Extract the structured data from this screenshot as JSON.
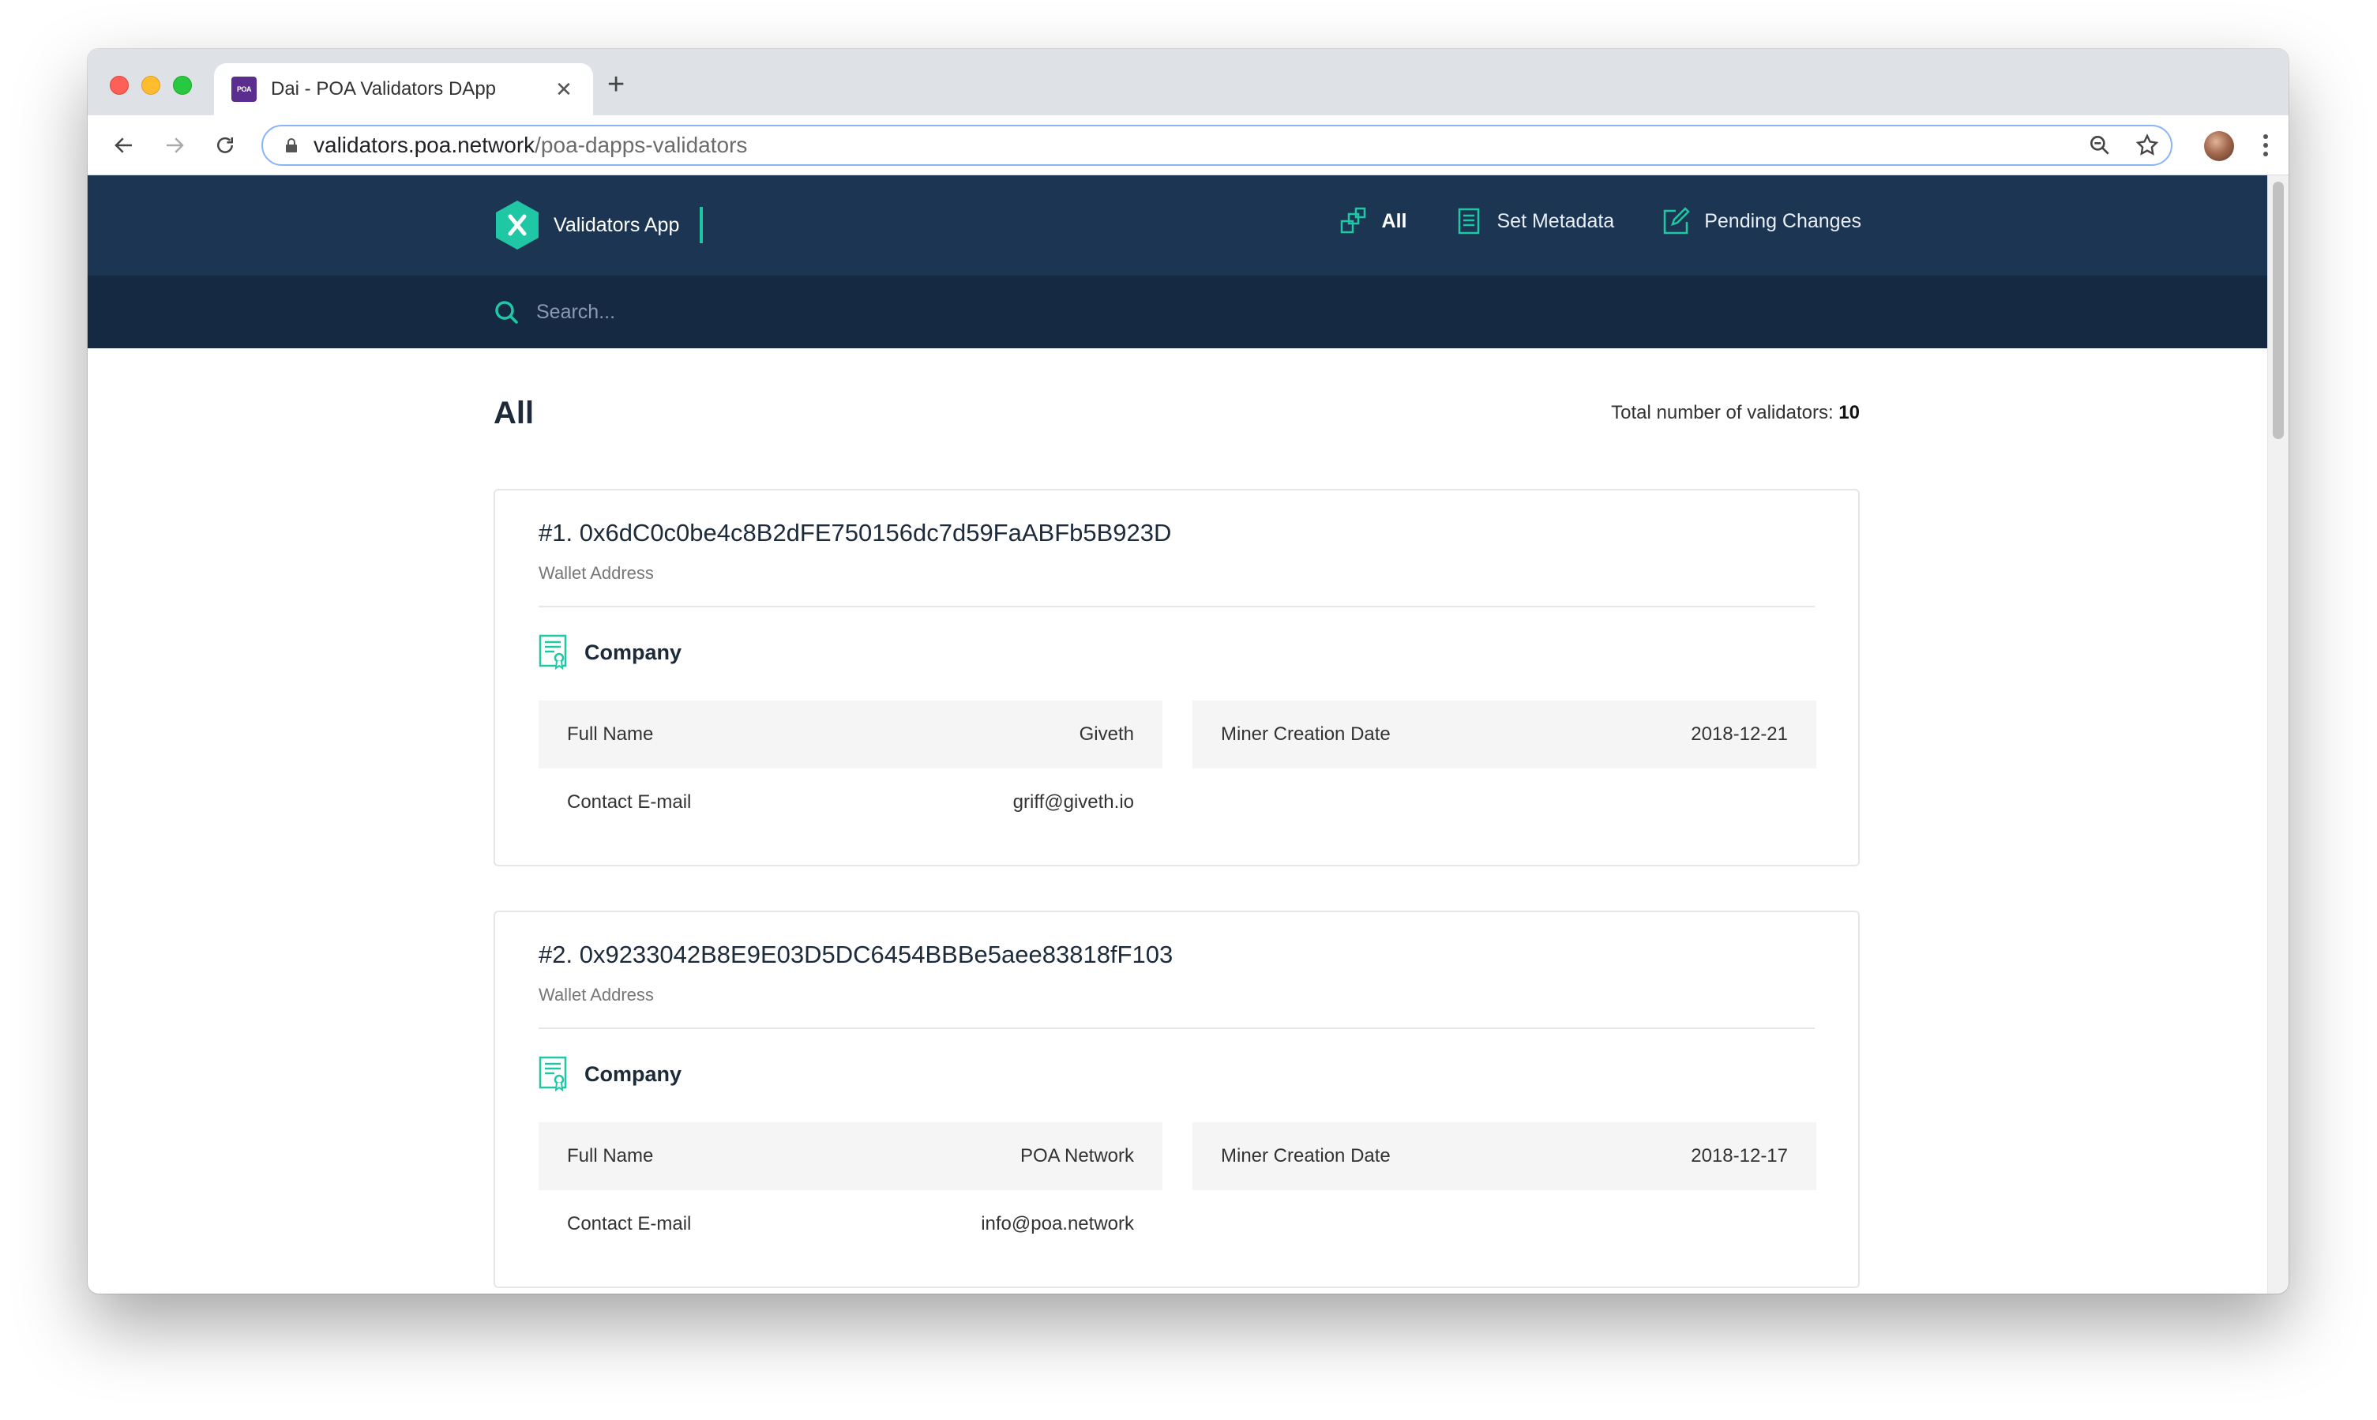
{
  "browser": {
    "tab_title": "Dai - POA Validators DApp",
    "favicon_text": "POA",
    "url_host": "validators.poa.network",
    "url_path": "/poa-dapps-validators"
  },
  "app": {
    "logo_text": "Validators App",
    "nav": [
      {
        "label": "All",
        "icon": "validators-icon"
      },
      {
        "label": "Set Metadata",
        "icon": "document-list-icon"
      },
      {
        "label": "Pending Changes",
        "icon": "edit-icon"
      }
    ],
    "search_placeholder": "Search..."
  },
  "page": {
    "title": "All",
    "total_label": "Total number of validators:",
    "total_value": "10"
  },
  "validators": [
    {
      "title": "#1. 0x6dC0c0be4c8B2dFE750156dc7d59FaABFb5B923D",
      "subtitle": "Wallet Address",
      "section": "Company",
      "full_name_label": "Full Name",
      "full_name": "Giveth",
      "miner_date_label": "Miner Creation Date",
      "miner_date": "2018-12-21",
      "email_label": "Contact E-mail",
      "email": "griff@giveth.io"
    },
    {
      "title": "#2. 0x9233042B8E9E03D5DC6454BBBe5aee83818fF103",
      "subtitle": "Wallet Address",
      "section": "Company",
      "full_name_label": "Full Name",
      "full_name": "POA Network",
      "miner_date_label": "Miner Creation Date",
      "miner_date": "2018-12-17",
      "email_label": "Contact E-mail",
      "email": "info@poa.network"
    }
  ],
  "colors": {
    "header_bg": "#1c3553",
    "search_bg": "#152a42",
    "accent": "#1fc7a5"
  }
}
